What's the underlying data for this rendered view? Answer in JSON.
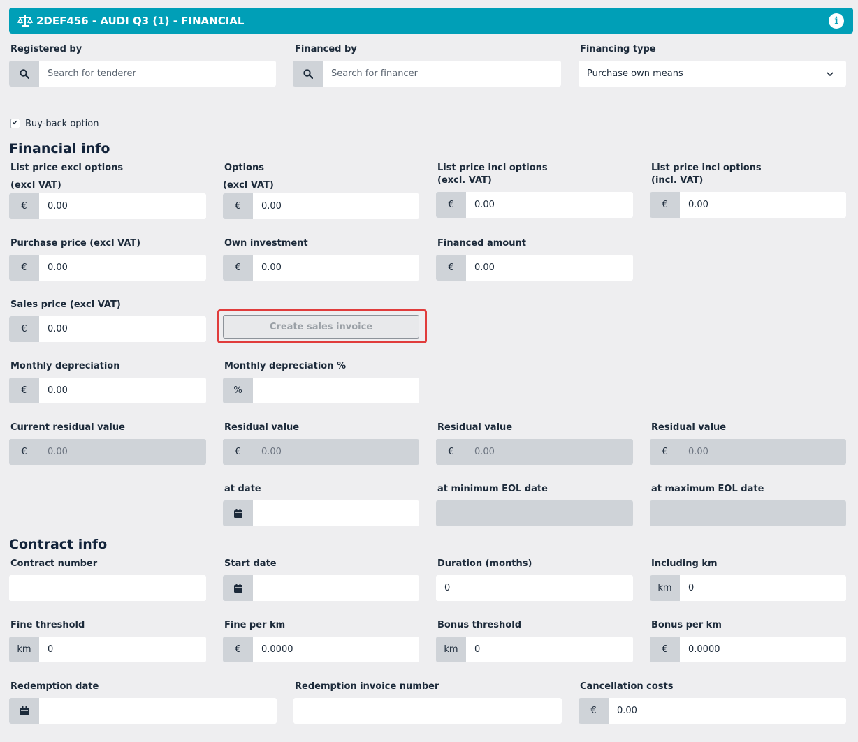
{
  "header": {
    "title": "2DEF456 - AUDI Q3 (1) - FINANCIAL",
    "info_icon": "i"
  },
  "top": {
    "registered_by": {
      "label": "Registered by",
      "placeholder": "Search for tenderer"
    },
    "financed_by": {
      "label": "Financed by",
      "placeholder": "Search for financer"
    },
    "financing_type": {
      "label": "Financing type",
      "value": "Purchase own means"
    },
    "buyback": {
      "label": "Buy-back option",
      "checked": true,
      "mark": "✔"
    }
  },
  "financial": {
    "title": "Financial info",
    "list_price_excl": {
      "label1": "List price excl options",
      "label2": "(excl VAT)",
      "addon": "€",
      "value": "0.00"
    },
    "options": {
      "label1": "Options",
      "label2": "(excl VAT)",
      "addon": "€",
      "value": "0.00"
    },
    "list_price_incl_excl": {
      "label1": "List price incl options",
      "label2": "(excl. VAT)",
      "addon": "€",
      "value": "0.00"
    },
    "list_price_incl_incl": {
      "label1": "List price incl options",
      "label2": "(incl. VAT)",
      "addon": "€",
      "value": "0.00"
    },
    "purchase_price": {
      "label": "Purchase price (excl VAT)",
      "addon": "€",
      "value": "0.00"
    },
    "own_investment": {
      "label": "Own investment",
      "addon": "€",
      "value": "0.00"
    },
    "financed_amount": {
      "label": "Financed amount",
      "addon": "€",
      "value": "0.00"
    },
    "sales_price": {
      "label": "Sales price  (excl VAT)",
      "addon": "€",
      "value": "0.00"
    },
    "create_invoice_button": "Create sales invoice",
    "monthly_depreciation": {
      "label": "Monthly depreciation",
      "addon": "€",
      "value": "0.00"
    },
    "monthly_depreciation_pct": {
      "label": "Monthly depreciation %",
      "addon": "%",
      "value": ""
    },
    "current_residual": {
      "label": "Current residual value",
      "addon": "€",
      "value": "0.00"
    },
    "residual_1": {
      "label": "Residual value",
      "addon": "€",
      "value": "0.00"
    },
    "residual_2": {
      "label": "Residual value",
      "addon": "€",
      "value": "0.00"
    },
    "residual_3": {
      "label": "Residual value",
      "addon": "€",
      "value": "0.00"
    },
    "at_date": {
      "label": "at date",
      "value": ""
    },
    "at_min_eol": {
      "label": "at minimum EOL date",
      "value": ""
    },
    "at_max_eol": {
      "label": "at maximum EOL date",
      "value": ""
    }
  },
  "contract": {
    "title": "Contract info",
    "contract_number": {
      "label": "Contract number",
      "value": ""
    },
    "start_date": {
      "label": "Start date",
      "value": ""
    },
    "duration": {
      "label": "Duration (months)",
      "value": "0"
    },
    "including_km": {
      "label": "Including km",
      "addon": "km",
      "value": "0"
    },
    "fine_threshold": {
      "label": "Fine threshold",
      "addon": "km",
      "value": "0"
    },
    "fine_per_km": {
      "label": "Fine per km",
      "addon": "€",
      "value": "0.0000"
    },
    "bonus_threshold": {
      "label": "Bonus threshold",
      "addon": "km",
      "value": "0"
    },
    "bonus_per_km": {
      "label": "Bonus per km",
      "addon": "€",
      "value": "0.0000"
    },
    "redemption_date": {
      "label": "Redemption date",
      "value": ""
    },
    "redemption_invoice": {
      "label": "Redemption invoice number",
      "value": ""
    },
    "cancellation_costs": {
      "label": "Cancellation costs",
      "addon": "€",
      "value": "0.00"
    }
  }
}
